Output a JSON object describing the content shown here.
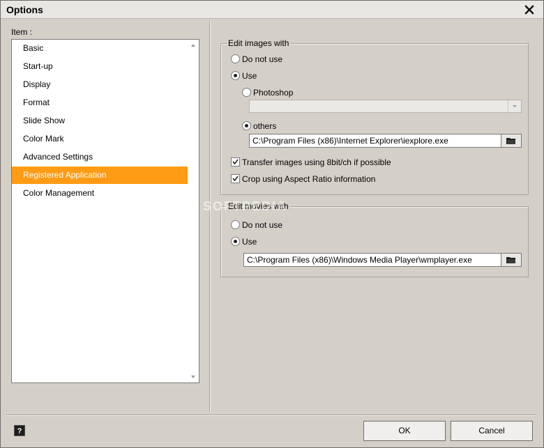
{
  "window": {
    "title": "Options"
  },
  "sidebar": {
    "label": "Item :",
    "items": [
      {
        "label": "Basic"
      },
      {
        "label": "Start-up"
      },
      {
        "label": "Display"
      },
      {
        "label": "Format"
      },
      {
        "label": "Slide Show"
      },
      {
        "label": "Color Mark"
      },
      {
        "label": "Advanced Settings"
      },
      {
        "label": "Registered Application",
        "selected": true
      },
      {
        "label": "Color Management"
      }
    ]
  },
  "edit_images": {
    "title": "Edit images with",
    "do_not_use_label": "Do not use",
    "use_label": "Use",
    "use_selected": true,
    "photoshop_label": "Photoshop",
    "photoshop_value": "",
    "others_label": "others",
    "others_selected": true,
    "others_path": "C:\\Program Files (x86)\\Internet Explorer\\iexplore.exe",
    "transfer_8bit_label": "Transfer images using 8bit/ch if possible",
    "transfer_8bit_checked": true,
    "crop_label": "Crop using Aspect Ratio information",
    "crop_checked": true
  },
  "edit_movies": {
    "title": "Edit movies with",
    "do_not_use_label": "Do not use",
    "use_label": "Use",
    "use_selected": true,
    "path": "C:\\Program Files (x86)\\Windows Media Player\\wmplayer.exe"
  },
  "footer": {
    "help_label": "?",
    "ok_label": "OK",
    "cancel_label": "Cancel"
  },
  "watermark": {
    "text": "SOFTPEDIA"
  },
  "colors": {
    "selection": "#ff9b14",
    "dialog_bg": "#d4d0c8"
  },
  "icons": {
    "close": "close-icon",
    "browse": "folder-icon",
    "help": "help-icon"
  }
}
